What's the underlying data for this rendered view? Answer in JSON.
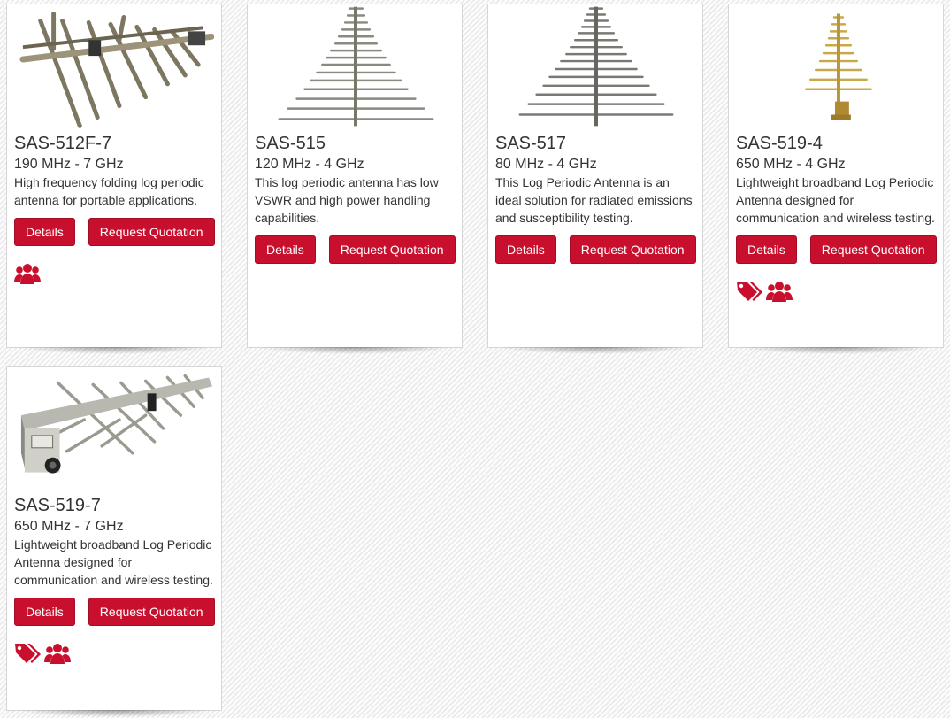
{
  "accent_color": "#c8102e",
  "products": [
    {
      "model": "SAS-512F-7",
      "freq": "190 MHz - 7 GHz",
      "desc": "High frequency folding log periodic antenna for portable applications.",
      "details_label": "Details",
      "quote_label": "Request Quotation",
      "icons": [
        "users-icon"
      ],
      "image": "folding-log-periodic-antenna-photo"
    },
    {
      "model": "SAS-515",
      "freq": "120 MHz - 4 GHz",
      "desc": "This log periodic antenna has low VSWR and high power handling capabilities.",
      "details_label": "Details",
      "quote_label": "Request Quotation",
      "icons": [],
      "image": "log-periodic-antenna-photo"
    },
    {
      "model": "SAS-517",
      "freq": "80 MHz - 4 GHz",
      "desc": "This Log Periodic Antenna is an ideal solution for radiated emissions and susceptibility testing.",
      "details_label": "Details",
      "quote_label": "Request Quotation",
      "icons": [],
      "image": "log-periodic-antenna-photo"
    },
    {
      "model": "SAS-519-4",
      "freq": "650 MHz - 4 GHz",
      "desc": "Lightweight broadband Log Periodic Antenna designed for communication and wireless testing.",
      "details_label": "Details",
      "quote_label": "Request Quotation",
      "icons": [
        "tags-icon",
        "users-icon"
      ],
      "image": "gold-log-periodic-antenna-photo"
    },
    {
      "model": "SAS-519-7",
      "freq": "650 MHz - 7 GHz",
      "desc": "Lightweight broadband Log Periodic Antenna designed for communication and wireless testing.",
      "details_label": "Details",
      "quote_label": "Request Quotation",
      "icons": [
        "tags-icon",
        "users-icon"
      ],
      "image": "log-periodic-antenna-side-photo"
    }
  ]
}
